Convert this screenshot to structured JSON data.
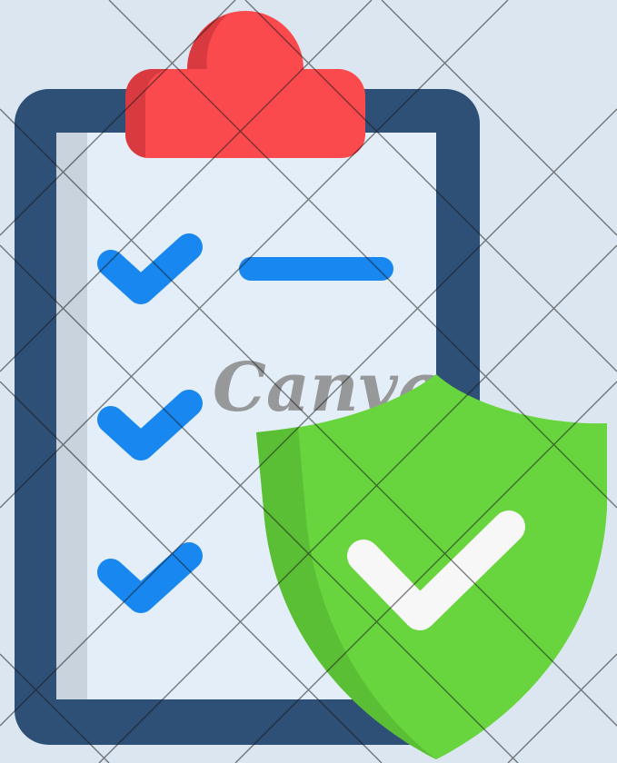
{
  "watermark": {
    "text": "Canva"
  },
  "illustration": {
    "subject": "clipboard-checklist-with-shield",
    "checklist_items": 3,
    "colors": {
      "background": "#dce6f1",
      "clipboard_frame": "#2e4f76",
      "clipboard_paper": "#e4eef9",
      "paper_shadow": "#c9d3de",
      "clip": "#fb4a4d",
      "clip_shadow": "#d93a3f",
      "checkmark": "#1888f0",
      "line": "#1888f0",
      "shield": "#68d43e",
      "shield_shadow": "#5bbf35",
      "shield_check": "#f7f7f7"
    }
  }
}
